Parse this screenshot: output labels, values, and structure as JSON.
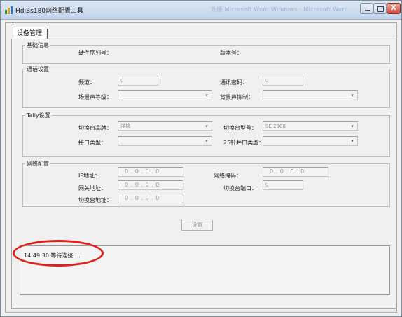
{
  "window": {
    "title": "HdiBs180网络配置工具",
    "ghost_title": "外接 Microsoft Word  Windows · Microsoft Word",
    "close_glyph": "X"
  },
  "tab": {
    "label": "设备管理"
  },
  "basic": {
    "legend": "基础信息",
    "serial_label": "硬件序列号：",
    "version_label": "版本号："
  },
  "comm": {
    "legend": "通话设置",
    "channel_label": "频道：",
    "channel_value": "0",
    "password_label": "通讯密码：",
    "password_value": "0",
    "scene_label": "场景声等级：",
    "scene_value": "",
    "bg_label": "背景声抑制：",
    "bg_value": ""
  },
  "tally": {
    "legend": "Tally设置",
    "brand_label": "切换台品牌：",
    "brand_value": "洋铭",
    "model_label": "切换台型号：",
    "model_value": "SE 2800",
    "iface_label": "接口类型：",
    "iface_value": "",
    "pin25_label": "25针并口类型：",
    "pin25_value": ""
  },
  "net": {
    "legend": "网络配置",
    "ip_label": "IP地址：",
    "ip_value": "0 . 0 . 0 . 0",
    "mask_label": "网络掩码：",
    "mask_value": "0 . 0 . 0 . 0",
    "gw_label": "网关地址：",
    "gw_value": "0 . 0 . 0 . 0",
    "port_label": "切换台端口：",
    "port_value": "0",
    "switch_addr_label": "切换台地址：",
    "switch_addr_value": "0 . 0 . 0 . 0"
  },
  "actions": {
    "set_label": "设置"
  },
  "log": {
    "line1": "14:49:30 等待连接 ..."
  },
  "colors": {
    "annotation": "#e0201b",
    "titlebar": "#c3d5ea"
  },
  "icons": {
    "app": "app-icon",
    "dropdown": "chevron-down-icon"
  }
}
